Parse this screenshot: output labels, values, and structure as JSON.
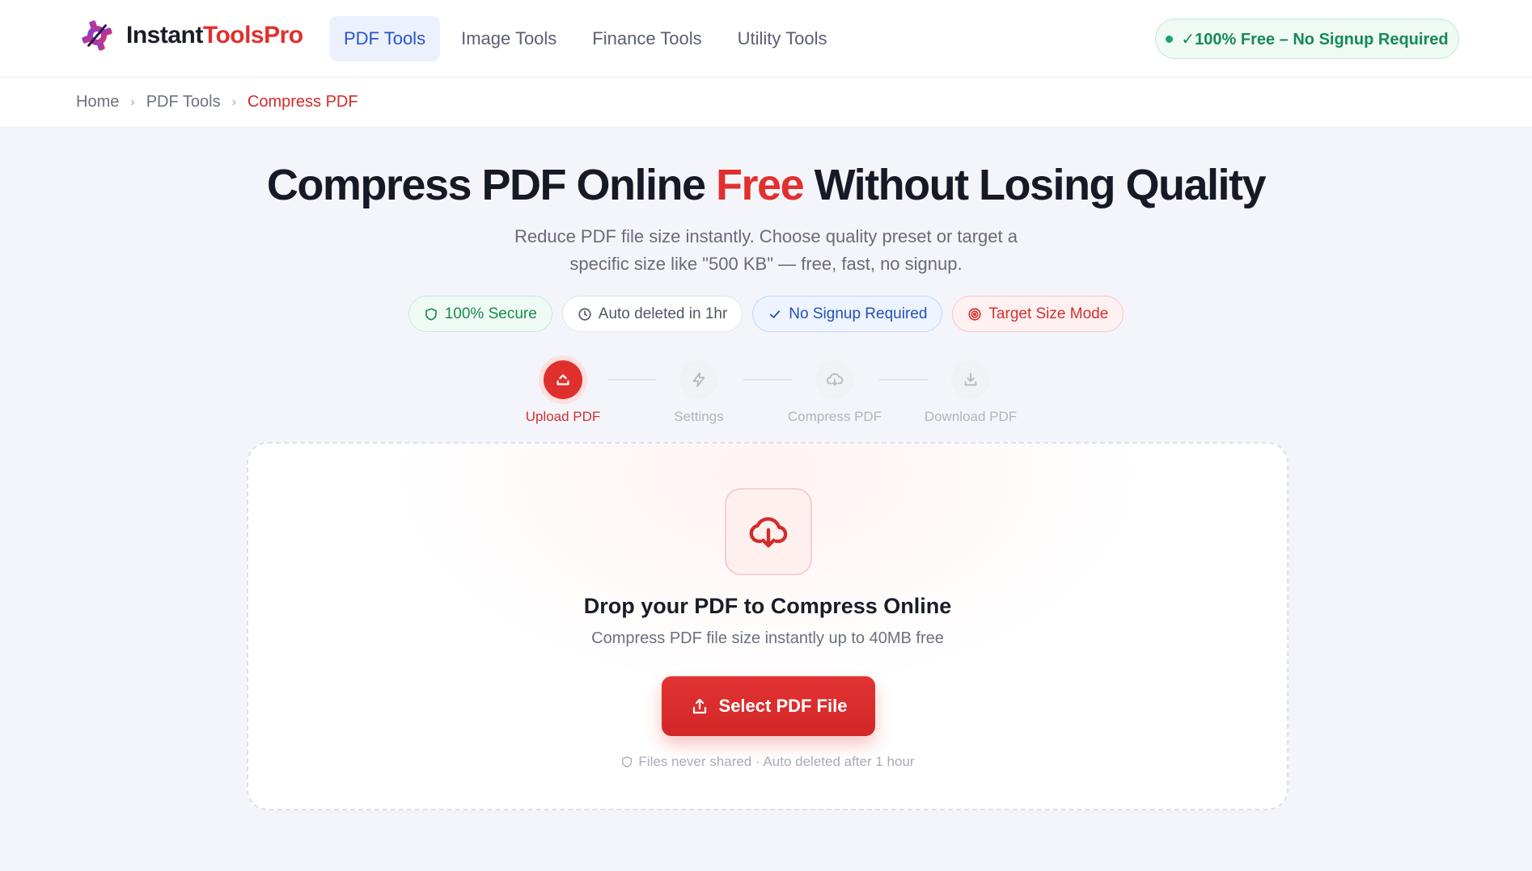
{
  "brand": {
    "name_part1": "Instant",
    "name_part2": "ToolsPro"
  },
  "nav": {
    "items": [
      {
        "label": "PDF Tools",
        "active": true
      },
      {
        "label": "Image Tools",
        "active": false
      },
      {
        "label": "Finance Tools",
        "active": false
      },
      {
        "label": "Utility Tools",
        "active": false
      }
    ],
    "free_pill": "✓100% Free – No Signup Required"
  },
  "breadcrumb": [
    "Home",
    "PDF Tools",
    "Compress PDF"
  ],
  "hero": {
    "title_part1": "Compress PDF Online ",
    "title_highlight": "Free",
    "title_part2": " Without Losing Quality",
    "subtitle": "Reduce PDF file size instantly. Choose quality preset or target a specific size like \"500 KB\" — free, fast, no signup."
  },
  "badges": [
    {
      "label": "100% Secure",
      "icon": "shield-icon"
    },
    {
      "label": "Auto deleted in 1hr",
      "icon": "clock-icon"
    },
    {
      "label": "No Signup Required",
      "icon": "check-icon"
    },
    {
      "label": "Target Size Mode",
      "icon": "target-icon"
    }
  ],
  "steps": [
    {
      "label": "Upload PDF",
      "icon": "upload-icon",
      "active": true
    },
    {
      "label": "Settings",
      "icon": "bolt-icon",
      "active": false
    },
    {
      "label": "Compress PDF",
      "icon": "cloud-icon",
      "active": false
    },
    {
      "label": "Download PDF",
      "icon": "download-icon",
      "active": false
    }
  ],
  "upload": {
    "title": "Drop your PDF to Compress Online",
    "subtitle": "Compress PDF file size instantly up to 40MB free",
    "button": "Select PDF File",
    "privacy": "Files never shared · Auto deleted after 1 hour"
  },
  "colors": {
    "accent": "#e0302e",
    "nav_active": "#2456c9",
    "success": "#17895a"
  }
}
